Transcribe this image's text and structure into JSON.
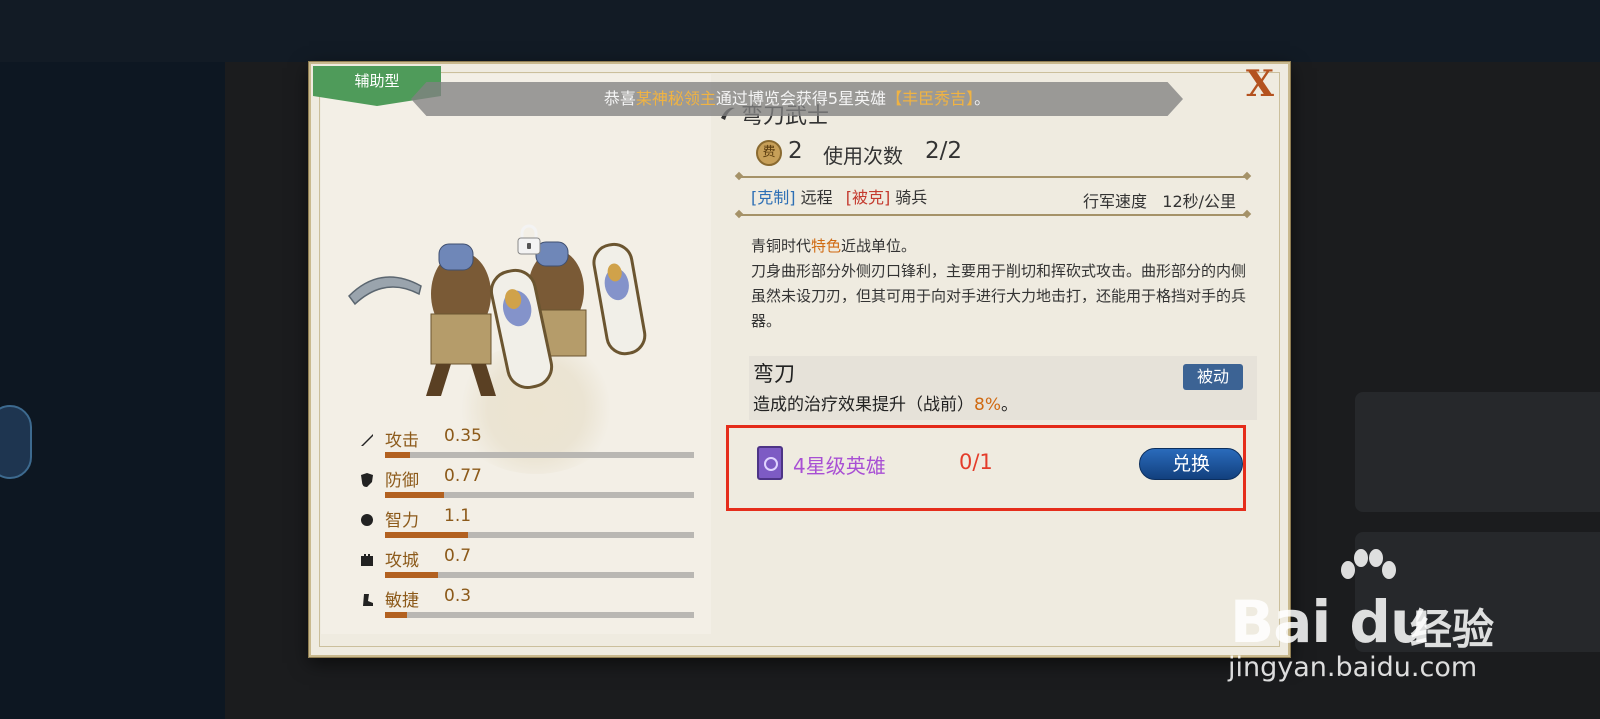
{
  "dialog": {
    "tag": "辅助型",
    "close_label": "X",
    "marquee": {
      "prefix": "恭喜",
      "player": "某神秘领主",
      "middle": "通过博览会获得5星英雄",
      "hero": "【丰臣秀吉】",
      "suffix": "。"
    },
    "unit": {
      "name": "弯刀武士",
      "cost_icon": "费",
      "cost": "2",
      "uses_label": "使用次数",
      "uses_value": "2/2",
      "counter_tag": "[克制]",
      "counter_value": "远程",
      "countered_tag": "[被克]",
      "countered_value": "骑兵",
      "speed_label": "行军速度",
      "speed_value": "12秒/公里",
      "desc_line1_prefix": "青铜时代",
      "desc_line1_hl": "特色",
      "desc_line1_suffix": "近战单位。",
      "desc_rest": "刀身曲形部分外侧刃口锋利，主要用于削切和挥砍式攻击。曲形部分的内侧虽然未设刀刃，但其可用于向对手进行大力地击打，还能用于格挡对手的兵器。"
    },
    "stats": [
      {
        "name": "攻击",
        "value": "0.35",
        "fill": 0.08,
        "icon": "sword-icon"
      },
      {
        "name": "防御",
        "value": "0.77",
        "fill": 0.19,
        "icon": "shield-icon"
      },
      {
        "name": "智力",
        "value": "1.1",
        "fill": 0.27,
        "icon": "brain-icon"
      },
      {
        "name": "攻城",
        "value": "0.7",
        "fill": 0.17,
        "icon": "castle-icon"
      },
      {
        "name": "敏捷",
        "value": "0.3",
        "fill": 0.07,
        "icon": "boot-icon"
      }
    ],
    "skill": {
      "name": "弯刀",
      "badge": "被动",
      "effect_prefix": "造成的治疗效果提升（战前）",
      "effect_pct": "8%",
      "effect_suffix": "。"
    },
    "exchange": {
      "hero_label": "4星级英雄",
      "count": "0/1",
      "button_label": "兑换"
    }
  },
  "watermark": {
    "brand": "Bai du",
    "suffix": "经验",
    "url": "jingyan.baidu.com"
  },
  "colors": {
    "accent_orange": "#d06a12",
    "counter_blue": "#2d6fb5",
    "countered_red": "#c43a2e",
    "highlight_box": "#e52d1b",
    "hero_purple": "#a84fd4",
    "tag_green": "#4f9b5a"
  }
}
